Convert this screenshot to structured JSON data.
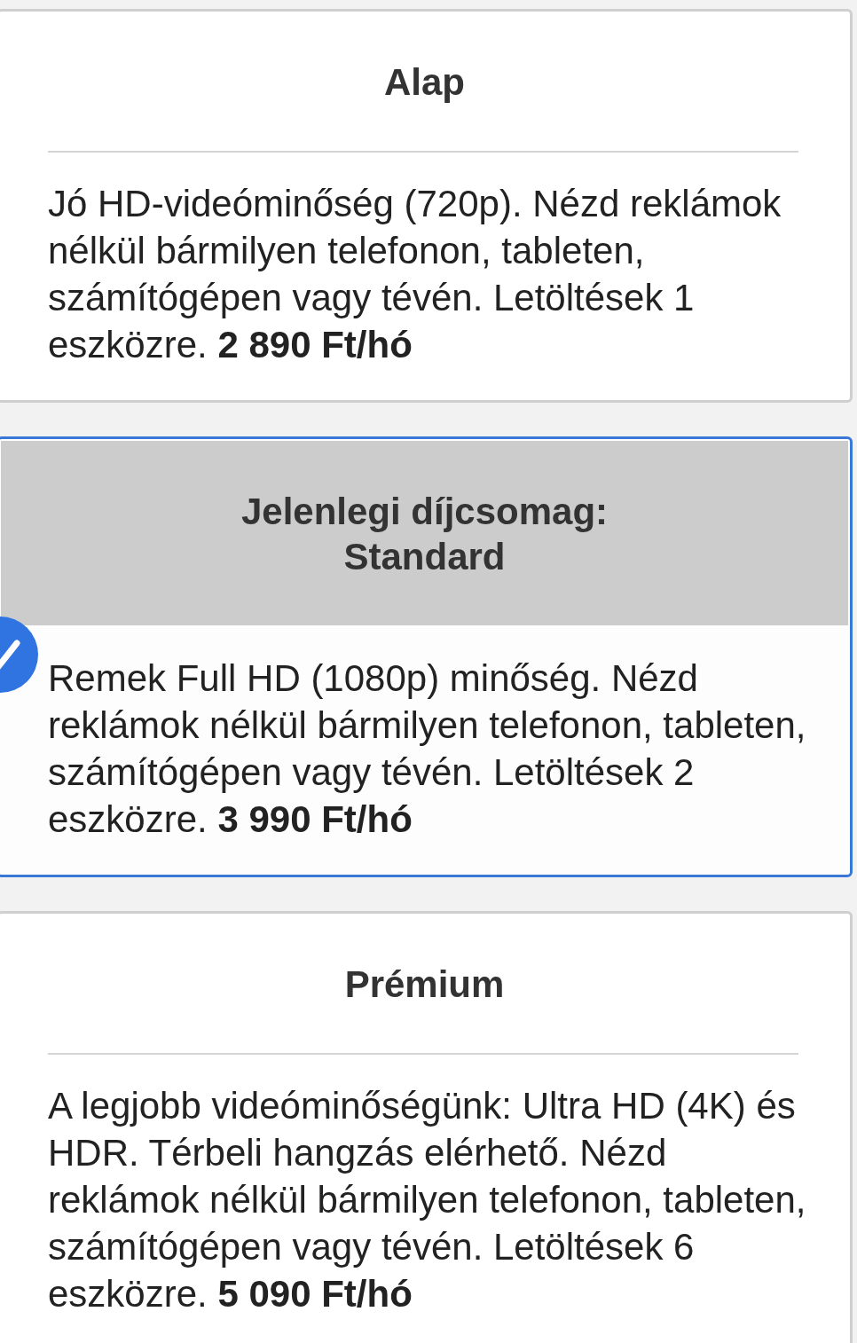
{
  "plans": [
    {
      "title": "Alap",
      "description": "Jó HD-videóminőség (720p). Nézd reklámok nélkül bármilyen telefonon, tableten, számítógépen vagy tévén. Letöltések 1 eszközre. **2 890 Ft/hó**",
      "selected": false
    },
    {
      "title": "Jelenlegi díjcsomag:\nStandard",
      "description": "Remek Full HD (1080p) minőség. Nézd reklámok nélkül bármilyen telefonon, tableten, számítógépen vagy tévén. Letöltések 2 eszközre. **3 990 Ft/hó**",
      "selected": true
    },
    {
      "title": "Prémium",
      "description": "A legjobb videóminőségünk: Ultra HD (4K) és HDR. Térbeli hangzás elérhető. Nézd reklámok nélkül bármilyen telefonon, tableten, számítógépen vagy tévén. Letöltések 6 eszközre. **5 090 Ft/hó**",
      "selected": false
    }
  ]
}
